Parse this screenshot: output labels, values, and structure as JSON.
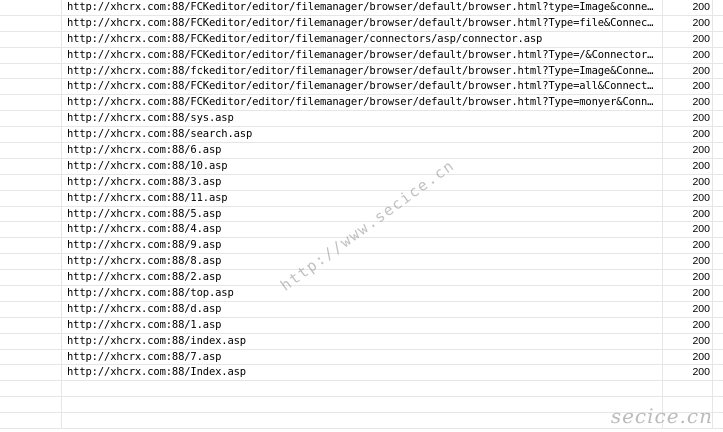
{
  "rows": [
    {
      "url": "http://xhcrx.com:88/FCKeditor/editor/filemanager/browser/default/browser.html?type=Image&connector=...",
      "status": "200"
    },
    {
      "url": "http://xhcrx.com:88/FCKeditor/editor/filemanager/browser/default/browser.html?Type=file&Connector=...",
      "status": "200"
    },
    {
      "url": "http://xhcrx.com:88/FCKeditor/editor/filemanager/connectors/asp/connector.asp",
      "status": "200"
    },
    {
      "url": "http://xhcrx.com:88/FCKeditor/editor/filemanager/browser/default/browser.html?Type=/&Connector=...",
      "status": "200"
    },
    {
      "url": "http://xhcrx.com:88/fckeditor/editor/filemanager/browser/default/browser.html?Type=Image&Connector=...",
      "status": "200"
    },
    {
      "url": "http://xhcrx.com:88/FCKeditor/editor/filemanager/browser/default/browser.html?Type=all&Connector=...",
      "status": "200"
    },
    {
      "url": "http://xhcrx.com:88/FCKeditor/editor/filemanager/browser/default/browser.html?Type=monyer&Connector=...",
      "status": "200"
    },
    {
      "url": "http://xhcrx.com:88/sys.asp",
      "status": "200"
    },
    {
      "url": "http://xhcrx.com:88/search.asp",
      "status": "200"
    },
    {
      "url": "http://xhcrx.com:88/6.asp",
      "status": "200"
    },
    {
      "url": "http://xhcrx.com:88/10.asp",
      "status": "200"
    },
    {
      "url": "http://xhcrx.com:88/3.asp",
      "status": "200"
    },
    {
      "url": "http://xhcrx.com:88/11.asp",
      "status": "200"
    },
    {
      "url": "http://xhcrx.com:88/5.asp",
      "status": "200"
    },
    {
      "url": "http://xhcrx.com:88/4.asp",
      "status": "200"
    },
    {
      "url": "http://xhcrx.com:88/9.asp",
      "status": "200"
    },
    {
      "url": "http://xhcrx.com:88/8.asp",
      "status": "200"
    },
    {
      "url": "http://xhcrx.com:88/2.asp",
      "status": "200"
    },
    {
      "url": "http://xhcrx.com:88/top.asp",
      "status": "200"
    },
    {
      "url": "http://xhcrx.com:88/d.asp",
      "status": "200"
    },
    {
      "url": "http://xhcrx.com:88/1.asp",
      "status": "200"
    },
    {
      "url": "http://xhcrx.com:88/index.asp",
      "status": "200"
    },
    {
      "url": "http://xhcrx.com:88/7.asp",
      "status": "200"
    },
    {
      "url": "http://xhcrx.com:88/Index.asp",
      "status": "200"
    },
    {
      "url": "",
      "status": ""
    },
    {
      "url": "",
      "status": ""
    },
    {
      "url": "",
      "status": ""
    }
  ],
  "watermark": {
    "diagonal": "http://www.secice.cn",
    "corner": "secice.cn"
  }
}
